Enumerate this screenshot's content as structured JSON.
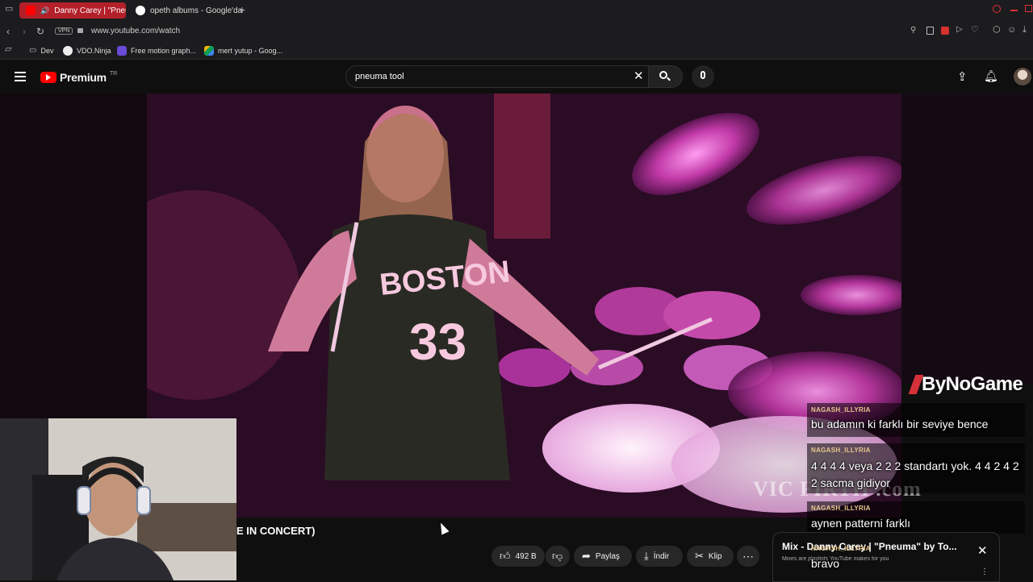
{
  "browser": {
    "tabs": [
      {
        "label": "Danny Carey | \"Pneum",
        "active": true
      },
      {
        "label": "opeth albums - Google'da",
        "active": false
      }
    ],
    "address": "www.youtube.com/watch",
    "vpn_label": "VPN",
    "bookmarks": [
      {
        "label": "Dev",
        "icon": "folder-icon"
      },
      {
        "label": "VDO.Ninja",
        "icon": "vdo-ninja-icon"
      },
      {
        "label": "Free motion graph...",
        "icon": "motion-icon"
      },
      {
        "label": "mert yutup - Goog...",
        "icon": "drive-icon"
      }
    ]
  },
  "youtube": {
    "logo": "Premium",
    "region": "TR",
    "search_value": "pneuma tool",
    "video_title_fragment": "E IN CONCERT)",
    "actions": {
      "likes": "492 B",
      "share": "Paylaş",
      "download": "İndir",
      "clip": "Klip"
    },
    "mix": {
      "title": "Mix - Danny Carey | \"Pneuma\" by To...",
      "subtitle": "Mixes are playlists YouTube makes for you"
    }
  },
  "overlay": {
    "watermark": "VIC FIRTH .com",
    "brand": "ByNoGame",
    "chat": [
      {
        "user": "NAGASH_ILLYRIA",
        "text": "bu adamın ki farklı bir seviye bence"
      },
      {
        "user": "NAGASH_ILLYRIA",
        "text": "4 4 4 4 veya 2 2 2 standartı yok. 4 4 2 4 2 2 sacma gidiyor"
      },
      {
        "user": "NAGASH_ILLYRIA",
        "text": "aynen patterni farklı"
      },
      {
        "user": "NAGASH_ILLYRIA",
        "text": "bravo"
      }
    ]
  },
  "colors": {
    "youtube_red": "#ff0000",
    "active_tab": "#b3202a",
    "chat_name": "#e8c88c"
  }
}
